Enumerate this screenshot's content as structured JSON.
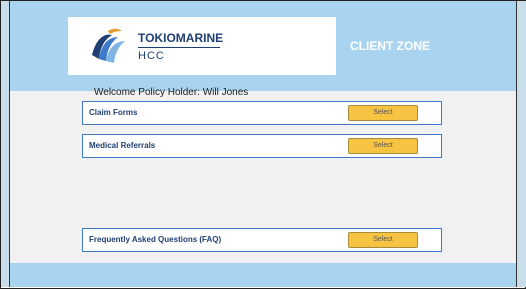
{
  "header": {
    "brand_line1": "TOKIOMARINE",
    "brand_line2": "HCC",
    "logo_icon": "tokio-marine-wave-logo",
    "zone_title": "CLIENT ZONE",
    "background_color": "#a9d4ef"
  },
  "welcome": {
    "text": "Welcome Policy Holder: Will Jones"
  },
  "menu": {
    "items": [
      {
        "label": "Claim Forms",
        "button_label": "Select"
      },
      {
        "label": "Medical Referrals",
        "button_label": "Select"
      },
      {
        "label": "Frequently Asked Questions (FAQ)",
        "button_label": "Select"
      }
    ]
  },
  "colors": {
    "accent_blue": "#3d79c8",
    "brand_navy": "#1f3f73",
    "button_yellow": "#f6c342"
  }
}
